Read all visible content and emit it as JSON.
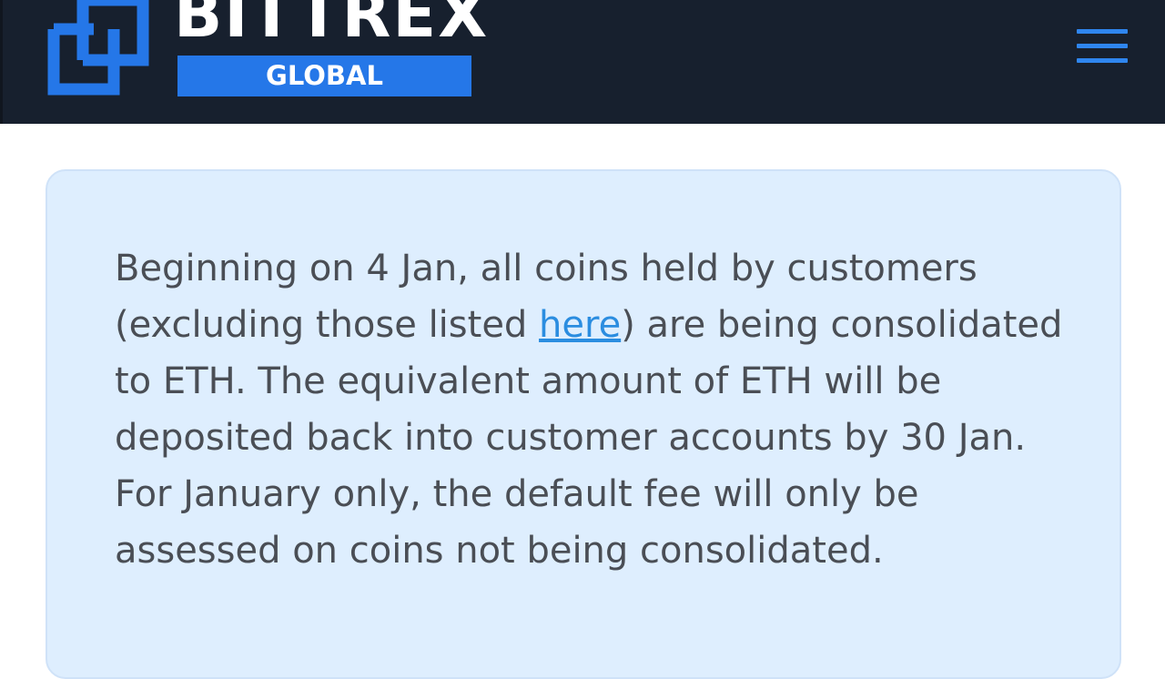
{
  "header": {
    "brand_name": "BITTREX",
    "brand_sub": "GLOBAL",
    "logo_icon": "bittrex-logo-icon",
    "menu_icon": "hamburger-menu-icon",
    "background_color": "#17202e",
    "accent_color": "#2577e8"
  },
  "notice": {
    "text_before_link": "Beginning on 4 Jan, all coins held by customers (excluding those listed ",
    "link_text": "here",
    "text_after_link": ") are being consolidated to ETH. The equivalent amount of ETH will be deposited back into customer accounts by 30 Jan. For January only, the default fee will only be assessed on coins not being consolidated.",
    "background_color": "#deeefe",
    "link_color": "#2b8de0"
  }
}
